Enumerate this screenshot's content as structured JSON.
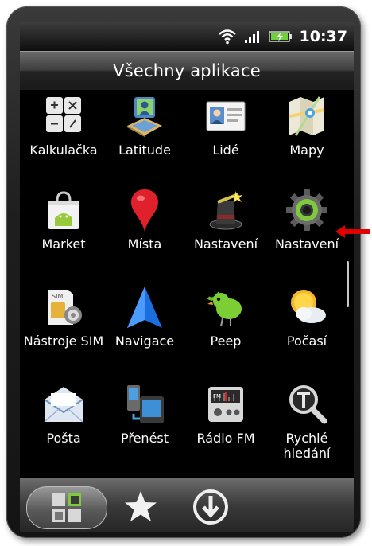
{
  "status_bar": {
    "time": "10:37",
    "icons": [
      "wifi-icon",
      "signal-icon",
      "battery-charging-icon"
    ]
  },
  "header": {
    "title": "Všechny aplikace"
  },
  "apps": [
    {
      "label": "Kalkulačka",
      "icon": "calculator-icon"
    },
    {
      "label": "Latitude",
      "icon": "latitude-icon"
    },
    {
      "label": "Lidé",
      "icon": "contacts-icon"
    },
    {
      "label": "Mapy",
      "icon": "maps-icon"
    },
    {
      "label": "Market",
      "icon": "market-icon"
    },
    {
      "label": "Místa",
      "icon": "places-pin-icon"
    },
    {
      "label": "Nastavení",
      "icon": "magic-hat-settings-icon"
    },
    {
      "label": "Nastavení",
      "icon": "gear-settings-icon"
    },
    {
      "label": "Nástroje SIM",
      "icon": "sim-toolkit-icon"
    },
    {
      "label": "Navigace",
      "icon": "navigation-arrow-icon"
    },
    {
      "label": "Peep",
      "icon": "peep-bird-icon"
    },
    {
      "label": "Počasí",
      "icon": "weather-icon"
    },
    {
      "label": "Pošta",
      "icon": "mail-icon"
    },
    {
      "label": "Přenést",
      "icon": "transfer-icon"
    },
    {
      "label": "Rádio FM",
      "icon": "fm-radio-icon"
    },
    {
      "label": "Rychlé hledání",
      "icon": "quick-search-icon"
    }
  ],
  "bottom_tabs": [
    {
      "name": "all-apps",
      "icon": "grid-apps-icon",
      "selected": true
    },
    {
      "name": "favorites",
      "icon": "star-icon",
      "selected": false
    },
    {
      "name": "downloads",
      "icon": "download-icon",
      "selected": false
    }
  ],
  "annotation": {
    "icon": "red-arrow-icon",
    "color": "#e00000"
  },
  "colors": {
    "accent_green": "#7ec93c",
    "arrow_red": "#e00000"
  }
}
